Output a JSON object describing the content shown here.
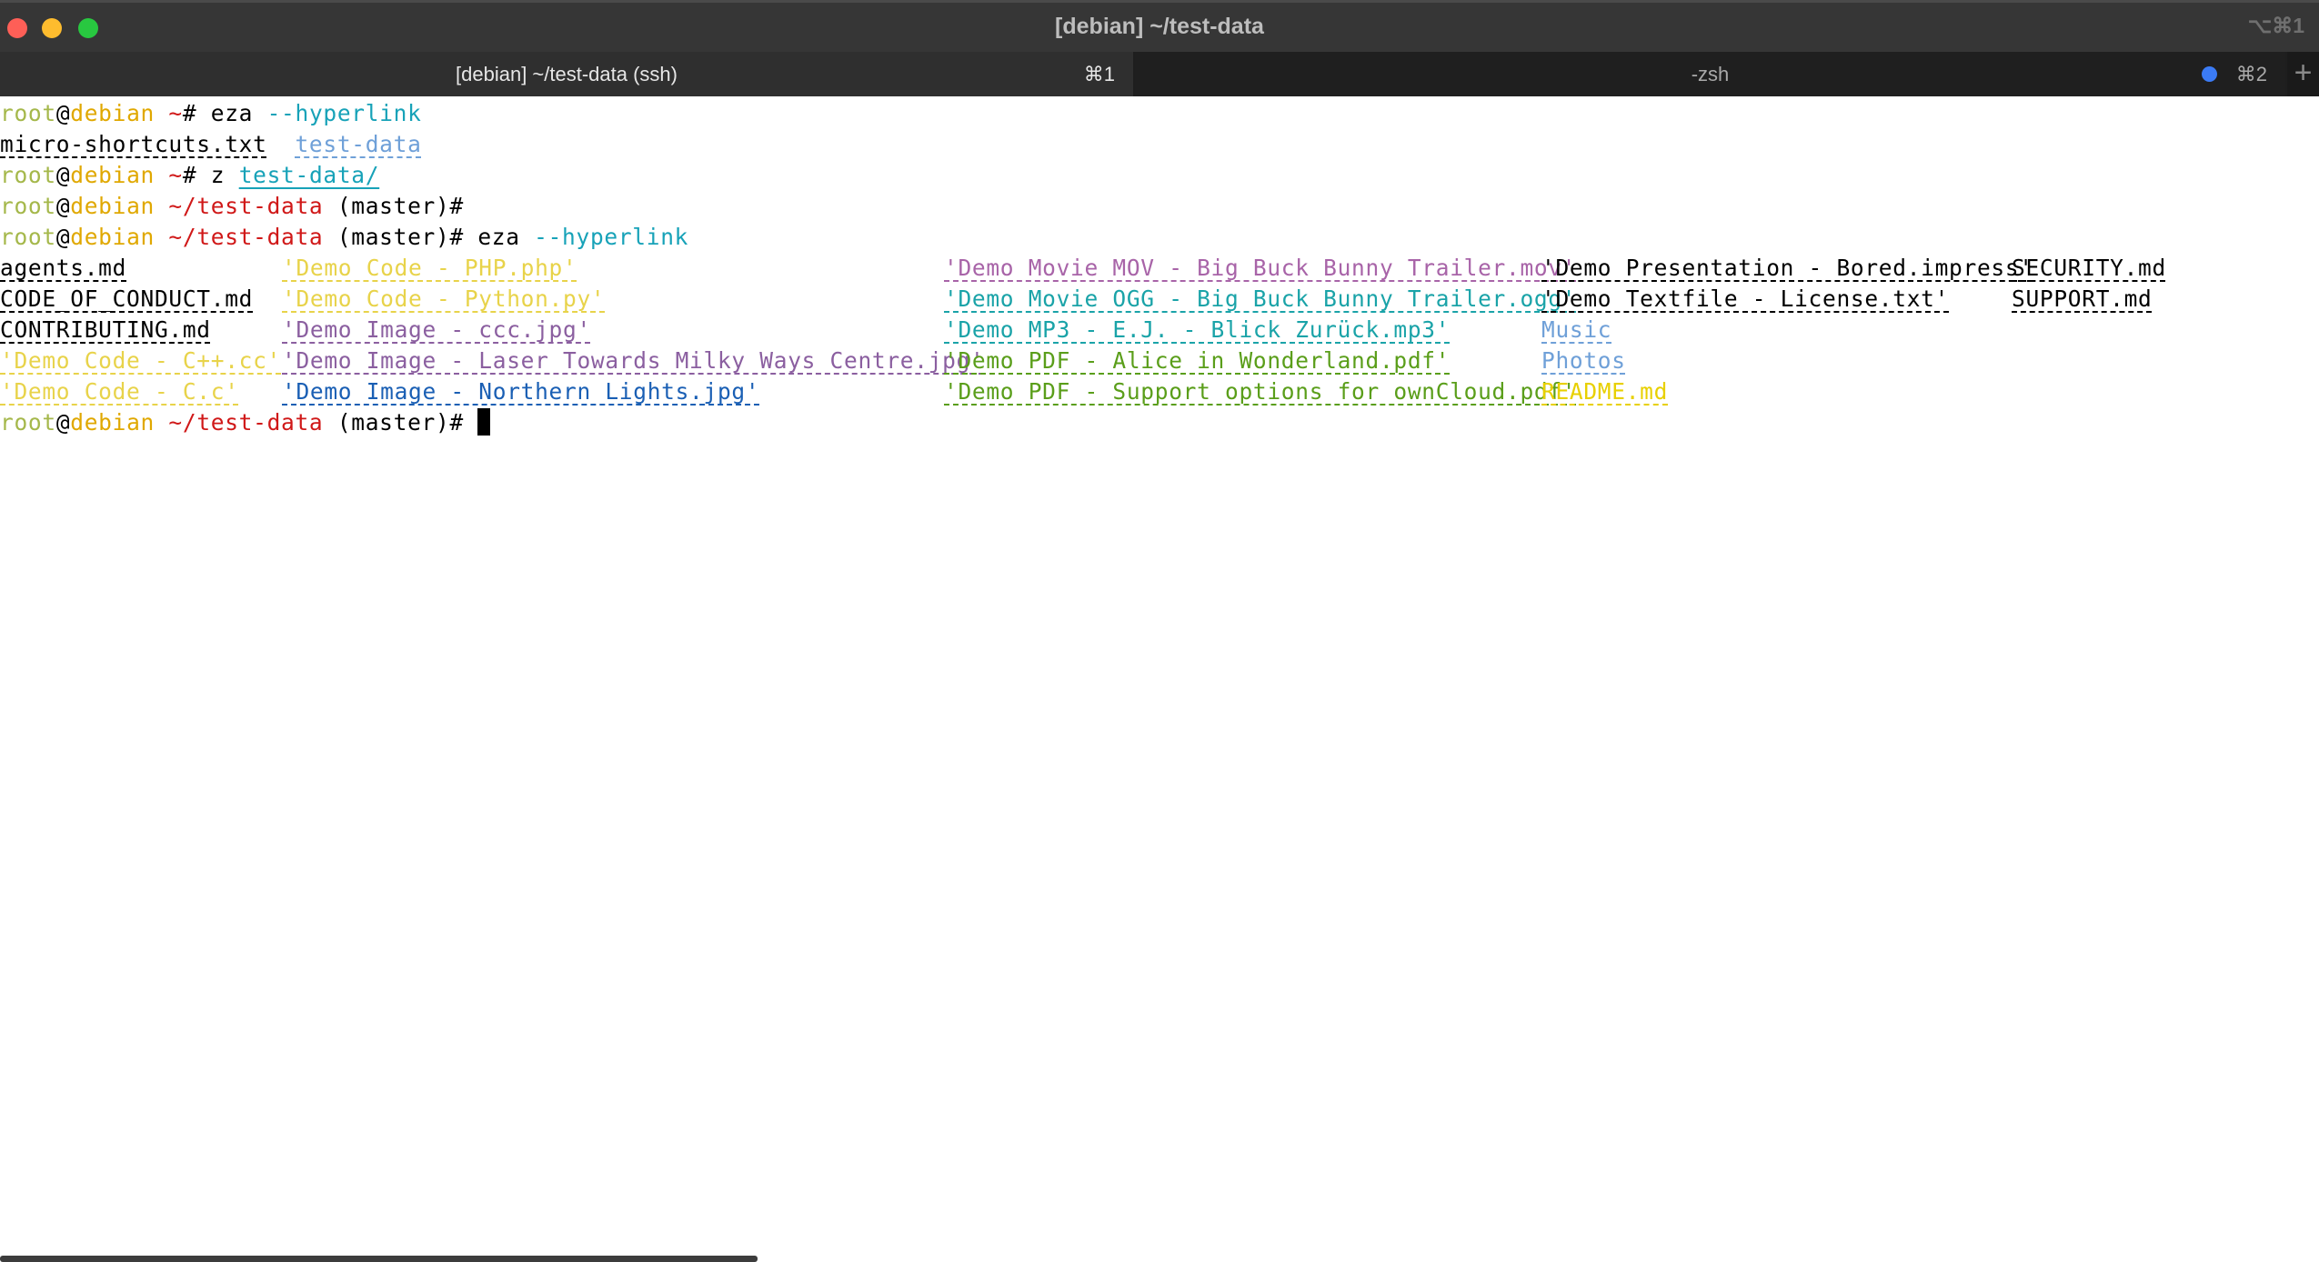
{
  "window": {
    "title": "[debian] ~/test-data",
    "shortcut": "⌥⌘1"
  },
  "tabs": [
    {
      "label": "[debian] ~/test-data (ssh)",
      "shortcut": "⌘1"
    },
    {
      "label": "-zsh",
      "shortcut": "⌘2"
    }
  ],
  "new_tab": "+",
  "prompt": {
    "user": "root",
    "at": "@",
    "host": "debian",
    "branch": " (master)",
    "sign": "# "
  },
  "lines": [
    {
      "path": " ~",
      "cmd": "eza",
      "arg": " --hyperlink"
    },
    {
      "col1": "micro-shortcuts.txt",
      "col2": "test-data"
    },
    {
      "path": " ~",
      "cmd": "z",
      "link": "test-data/"
    },
    {
      "path": " ~/test-data",
      "cmd": ""
    },
    {
      "path": " ~/test-data",
      "cmd": "eza",
      "arg": " --hyperlink"
    },
    {
      "path": " ~/test-data",
      "cmd": ""
    }
  ],
  "listing": [
    [
      "agents.md",
      "'Demo Code - PHP.php'",
      "'Demo Movie MOV - Big Buck Bunny Trailer.mov'",
      "'Demo Presentation - Bored.impress'",
      "SECURITY.md"
    ],
    [
      "CODE_OF_CONDUCT.md",
      "'Demo Code - Python.py'",
      "'Demo Movie OGG - Big Buck Bunny Trailer.ogg'",
      "'Demo Textfile - License.txt'",
      "SUPPORT.md"
    ],
    [
      "CONTRIBUTING.md",
      "'Demo Image - ccc.jpg'",
      "'Demo MP3 - E.J. - Blick Zurück.mp3'",
      "Music",
      ""
    ],
    [
      "'Demo Code - C++.cc'",
      "'Demo Image - Laser Towards Milky Ways Centre.jpg'",
      "'Demo PDF - Alice in Wonderland.pdf'",
      "Photos",
      ""
    ],
    [
      "'Demo Code - C.c'",
      "'Demo Image - Northern Lights.jpg'",
      "'Demo PDF - Support options for ownCloud.pdf'",
      "README.md",
      ""
    ]
  ],
  "colors": {
    "user": "#a5b84b",
    "host": "#e0a800",
    "path": "#d01818",
    "command": "#17a2b8",
    "directory": "#6fa0d8",
    "source_code": "#e8d34a",
    "image": "#8b5fa0",
    "movie": "#a864a8",
    "audio": "#1aa3a8",
    "document": "#5a9e1a",
    "readme": "#e8d000",
    "northern_lights": "#1a5fb4",
    "plain": "#000000"
  }
}
